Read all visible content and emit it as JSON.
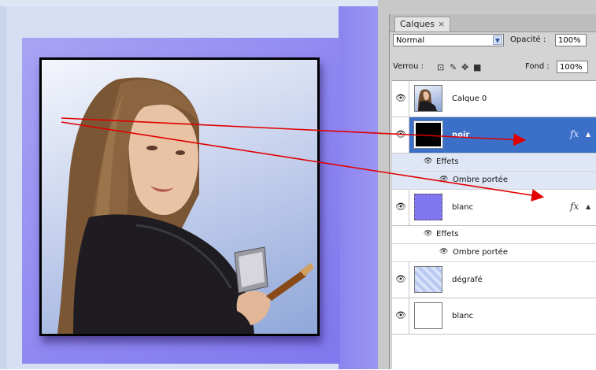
{
  "panel": {
    "tab_label": "Calques",
    "tab_close": "×",
    "blend_mode": "Normal",
    "opacity_label": "Opacité :",
    "opacity_value": "100%",
    "lock_label": "Verrou :",
    "fill_label": "Fond :",
    "fill_value": "100%"
  },
  "layers": [
    {
      "name": "Calque 0",
      "selected": false,
      "fx": false
    },
    {
      "name": "noir",
      "selected": true,
      "fx": true,
      "effects_label": "Effets",
      "effect": "Ombre portée"
    },
    {
      "name": "blanc",
      "selected": false,
      "fx": true,
      "effects_label": "Effets",
      "effect": "Ombre portée"
    },
    {
      "name": "dégrafé",
      "selected": false,
      "fx": false
    },
    {
      "name": "blanc",
      "selected": false,
      "fx": false
    }
  ],
  "icons": {
    "fx": "fx",
    "eye": "eye-icon",
    "caret": "▲"
  },
  "colors": {
    "selection": "#3c6fc8",
    "arrow": "#e00000",
    "purple_square": "#8e86f0"
  }
}
